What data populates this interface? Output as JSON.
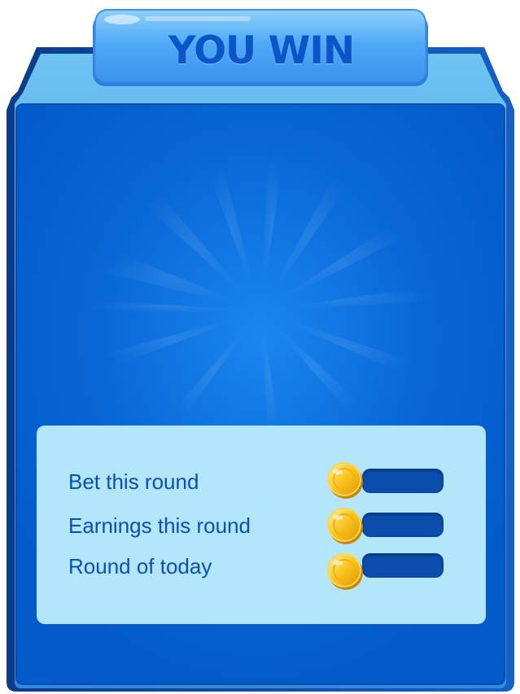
{
  "popup": {
    "title": "YOU WIN",
    "colors": {
      "frame_light": "#7ccdf6",
      "frame_dark": "#0a3f8f",
      "panel_bg": "#045bc9",
      "ribbon": "#4aa3f5",
      "stats_bg": "#b3e6fb",
      "label_text": "#0a4fb8",
      "value_bar": "#0b4dad",
      "coin": "#f7c21d"
    }
  },
  "stats": [
    {
      "label": "Bet this round",
      "value": "",
      "icon": "gold-coin-icon"
    },
    {
      "label": "Earnings this round",
      "value": "",
      "icon": "gold-coin-icon"
    },
    {
      "label": "Round of today",
      "value": "",
      "icon": "gold-coin-icon"
    }
  ]
}
